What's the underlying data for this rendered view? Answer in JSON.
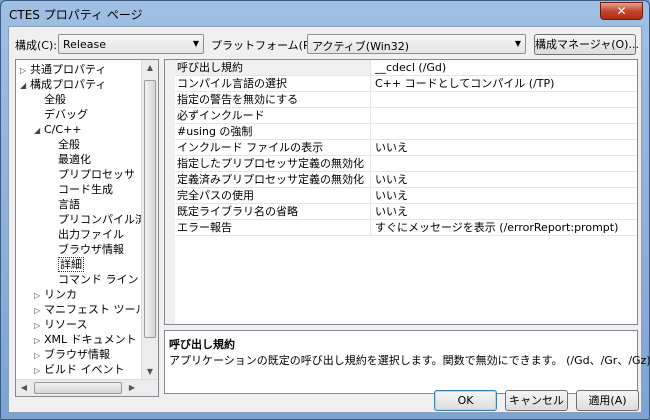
{
  "window": {
    "title": "CTES プロパティ ページ",
    "close_glyph": "✕"
  },
  "toolbar": {
    "config_label": "構成(C):",
    "config_value": "Release",
    "platform_label": "プラットフォーム(P):",
    "platform_value": "アクティブ(Win32)",
    "config_manager_label": "構成マネージャ(O)..."
  },
  "tree": [
    {
      "label": "共通プロパティ",
      "level": 0,
      "expander": "▷"
    },
    {
      "label": "構成プロパティ",
      "level": 0,
      "expander": "◢"
    },
    {
      "label": "全般",
      "level": 1,
      "expander": ""
    },
    {
      "label": "デバッグ",
      "level": 1,
      "expander": ""
    },
    {
      "label": "C/C++",
      "level": 1,
      "expander": "◢"
    },
    {
      "label": "全般",
      "level": 2,
      "expander": ""
    },
    {
      "label": "最適化",
      "level": 2,
      "expander": ""
    },
    {
      "label": "プリプロセッサ",
      "level": 2,
      "expander": ""
    },
    {
      "label": "コード生成",
      "level": 2,
      "expander": ""
    },
    {
      "label": "言語",
      "level": 2,
      "expander": ""
    },
    {
      "label": "プリコンパイル済み",
      "level": 2,
      "expander": ""
    },
    {
      "label": "出力ファイル",
      "level": 2,
      "expander": ""
    },
    {
      "label": "ブラウザ情報",
      "level": 2,
      "expander": ""
    },
    {
      "label": "詳細",
      "level": 2,
      "expander": "",
      "selected": true
    },
    {
      "label": "コマンド ライン",
      "level": 2,
      "expander": ""
    },
    {
      "label": "リンカ",
      "level": 1,
      "expander": "▷"
    },
    {
      "label": "マニフェスト ツール",
      "level": 1,
      "expander": "▷"
    },
    {
      "label": "リソース",
      "level": 1,
      "expander": "▷"
    },
    {
      "label": "XML ドキュメント ジェ",
      "level": 1,
      "expander": "▷"
    },
    {
      "label": "ブラウザ情報",
      "level": 1,
      "expander": "▷"
    },
    {
      "label": "ビルド イベント",
      "level": 1,
      "expander": "▷"
    }
  ],
  "properties": [
    {
      "name": "呼び出し規約",
      "value": "__cdecl (/Gd)"
    },
    {
      "name": "コンパイル言語の選択",
      "value": "C++ コードとしてコンパイル (/TP)"
    },
    {
      "name": "指定の警告を無効にする",
      "value": ""
    },
    {
      "name": "必ずインクルード",
      "value": ""
    },
    {
      "name": "#using の強制",
      "value": ""
    },
    {
      "name": "インクルード ファイルの表示",
      "value": "いいえ"
    },
    {
      "name": "指定したプリプロセッサ定義の無効化",
      "value": ""
    },
    {
      "name": "定義済みプリプロセッサ定義の無効化",
      "value": "いいえ"
    },
    {
      "name": "完全パスの使用",
      "value": "いいえ"
    },
    {
      "name": "既定ライブラリ名の省略",
      "value": "いいえ"
    },
    {
      "name": "エラー報告",
      "value": "すぐにメッセージを表示 (/errorReport:prompt)"
    }
  ],
  "description": {
    "title": "呼び出し規約",
    "text": "アプリケーションの既定の呼び出し規約を選択します。関数で無効にできます。   (/Gd、/Gr、/Gz)"
  },
  "buttons": {
    "ok": "OK",
    "cancel": "キャンセル",
    "apply": "適用(A)"
  }
}
